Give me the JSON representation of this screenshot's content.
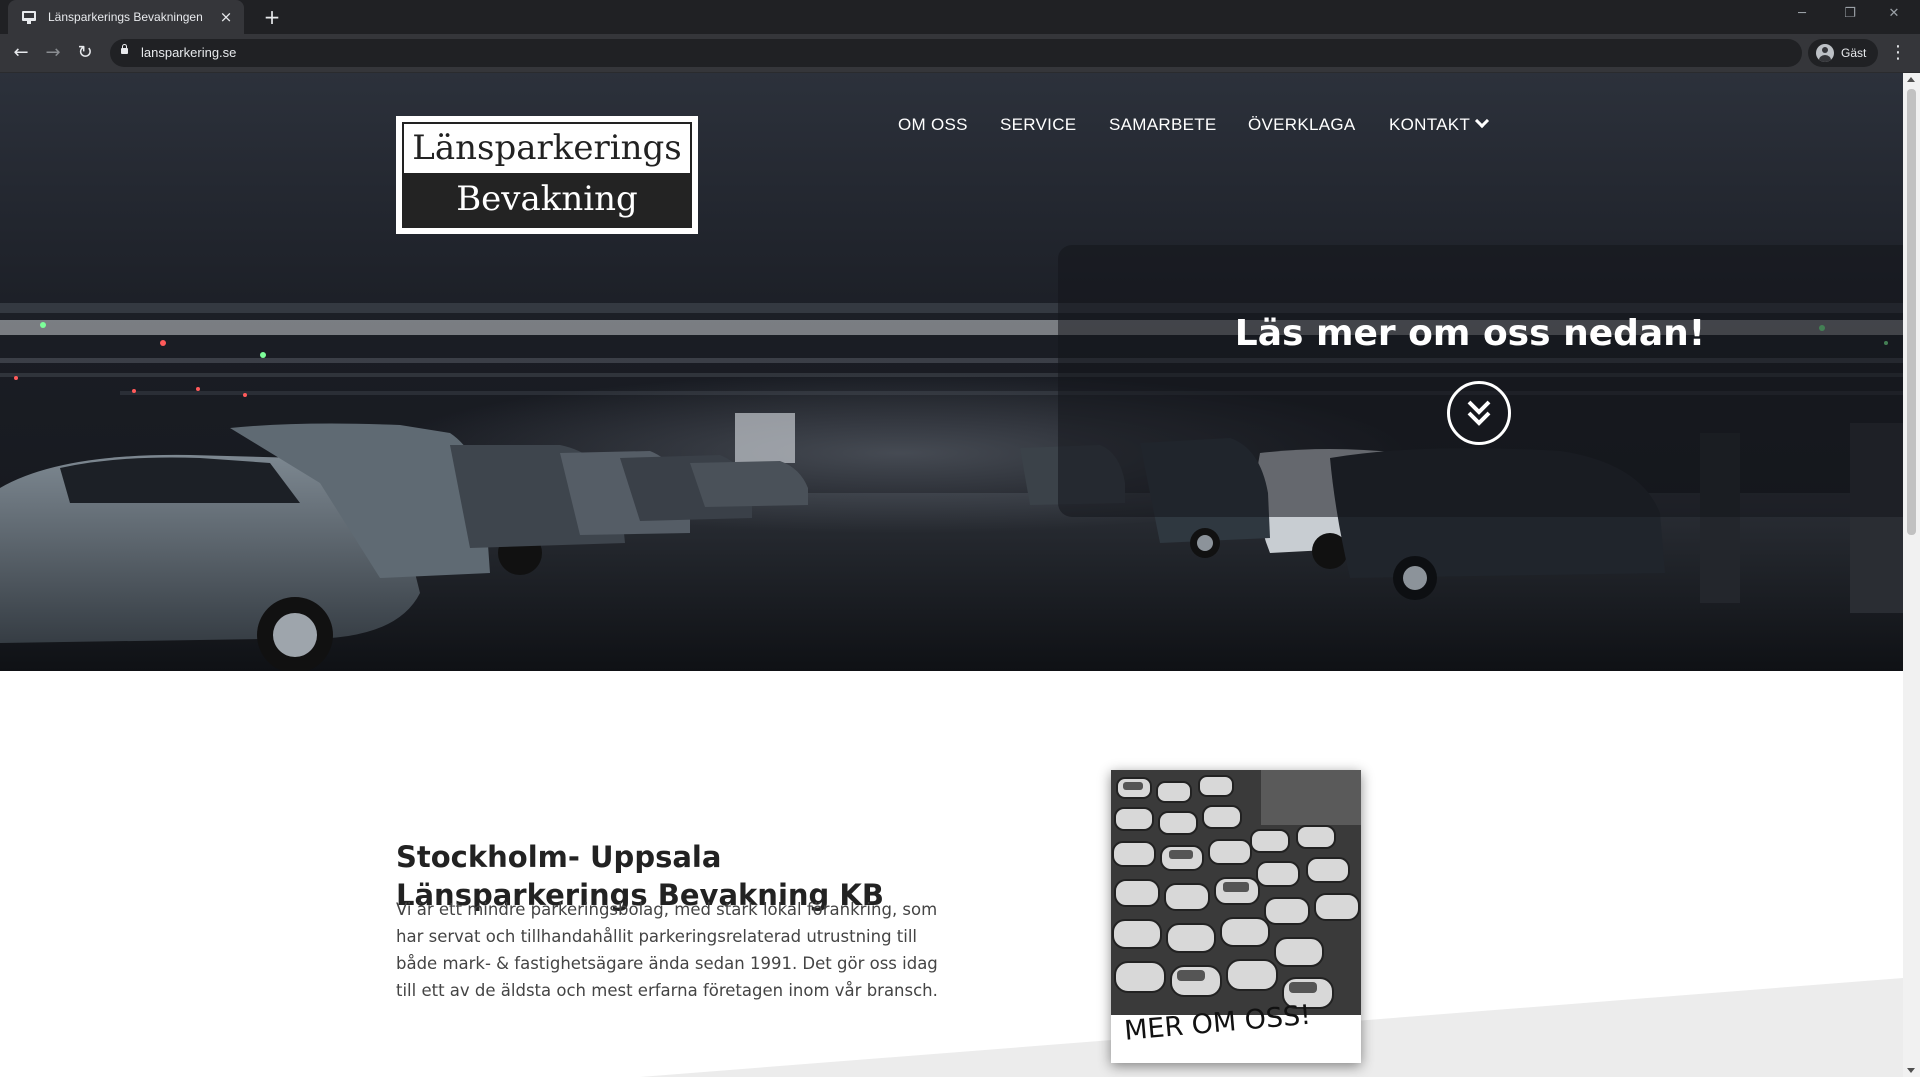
{
  "browser": {
    "tab_title": "Länsparkerings Bevakningen",
    "url": "lansparkering.se",
    "profile_name": "Gäst",
    "new_tab": "+",
    "tab_close": "×",
    "window": {
      "minimize": "─",
      "restore": "❐",
      "close": "✕"
    },
    "nav": {
      "back": "←",
      "forward": "→",
      "reload": "↻",
      "menu": "⋮"
    }
  },
  "logo": {
    "line1": "Länsparkerings",
    "line2": "Bevakning"
  },
  "nav": {
    "items": [
      {
        "label": "OM OSS"
      },
      {
        "label": "SERVICE"
      },
      {
        "label": "SAMARBETE"
      },
      {
        "label": "ÖVERKLAGA"
      },
      {
        "label": "KONTAKT"
      }
    ]
  },
  "hero": {
    "cta_title": "Läs mer om oss nedan!"
  },
  "content": {
    "heading": "Stockholm- Uppsala Länsparkerings Bevakning KB",
    "body": "Vi är ett mindre parkeringsbolag, med stark lokal förankring, som har servat och tillhandahållit parkeringsrelaterad utrustning till både mark- & fastighetsägare ända sedan 1991. Det gör oss idag till ett av de äldsta och mest erfarna företagen inom vår bransch.",
    "polaroid_label": "MER OM OSS!"
  },
  "colors": {
    "chrome_dark": "#202124",
    "chrome_mid": "#35363a",
    "hero_dark": "#1b1f27",
    "text_dark": "#222222",
    "text_body": "#444444"
  }
}
